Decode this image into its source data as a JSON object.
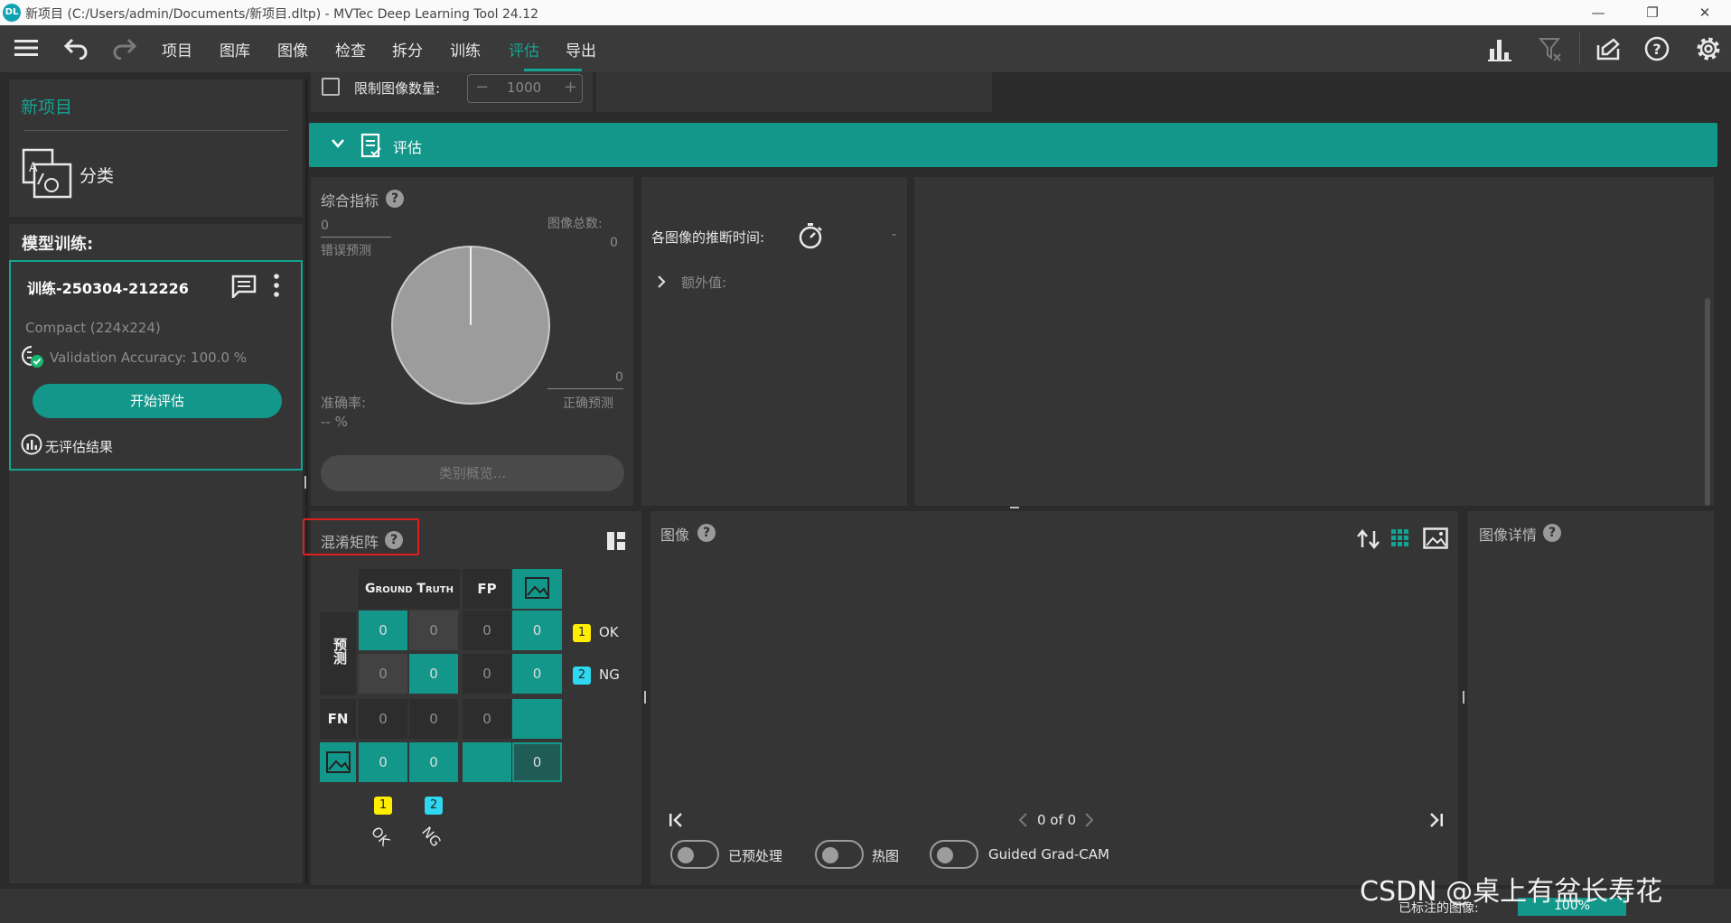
{
  "window": {
    "title": "新项目 (C:/Users/admin/Documents/新项目.dltp) - MVTec Deep Learning Tool 24.12",
    "logo": "DL",
    "minimize": "—",
    "maximize": "❐",
    "close": "✕"
  },
  "menu": {
    "items": [
      "项目",
      "图库",
      "图像",
      "检查",
      "拆分",
      "训练",
      "评估",
      "导出"
    ],
    "active_index": 6
  },
  "project": {
    "name": "新项目",
    "type": "分类"
  },
  "training": {
    "header": "模型训练:",
    "name": "训练-250304-212226",
    "model": "Compact (224x224)",
    "validation": "Validation Accuracy: 100.0 %",
    "start_button": "开始评估",
    "no_result": "无评估结果"
  },
  "limit": {
    "label": "限制图像数量:",
    "value": "1000",
    "minus": "−",
    "plus": "+"
  },
  "eval_bar": {
    "label": "评估"
  },
  "metrics": {
    "title": "综合指标",
    "wrong_value": "0",
    "wrong_label": "错误预测",
    "total_label": "图像总数:",
    "total_value": "0",
    "correct_value": "0",
    "correct_label": "正确预测",
    "accuracy_label": "准确率:",
    "accuracy_value": "-- %",
    "class_overview_button": "类别概览..."
  },
  "inference": {
    "label": "各图像的推断时间:",
    "value": "-",
    "extra": "额外值:"
  },
  "confusion": {
    "title": "混淆矩阵",
    "header_gt": "Ground Truth",
    "header_fp": "FP",
    "row_label": "预测",
    "fn_label": "FN",
    "matrix": [
      [
        "0",
        "0"
      ],
      [
        "0",
        "0"
      ]
    ],
    "fp": [
      "0",
      "0"
    ],
    "fn": [
      "0",
      "0"
    ],
    "img_col": [
      "0",
      "0"
    ],
    "img_row": [
      "0",
      "0"
    ],
    "corner": "0",
    "classes": [
      {
        "id": "1",
        "name": "OK",
        "color": "#ffee00"
      },
      {
        "id": "2",
        "name": "NG",
        "color": "#2ed8f0"
      }
    ]
  },
  "images": {
    "title": "图像",
    "pager": "0 of 0",
    "toggles": [
      "已预处理",
      "热图",
      "Guided Grad-CAM"
    ]
  },
  "details": {
    "title": "图像详情"
  },
  "status": {
    "label": "已标注的图像:",
    "value": "100%"
  },
  "watermark": "CSDN @桌上有盆长寿花",
  "colors": {
    "accent": "#12a594",
    "highlight": "#e02020"
  }
}
